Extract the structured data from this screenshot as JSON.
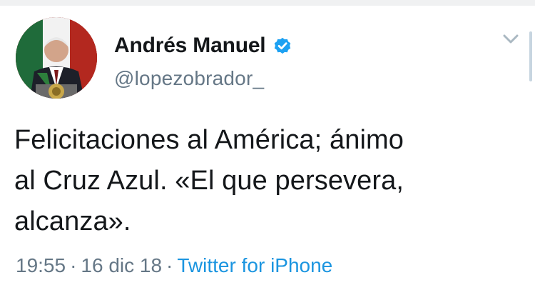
{
  "user": {
    "display_name": "Andrés Manuel",
    "handle": "@lopezobrador_",
    "verified_icon": "verified-badge-icon"
  },
  "tweet": {
    "text_line1": "Felicitaciones al América; ánimo",
    "text_line2": "al Cruz Azul. «El que persevera,",
    "text_line3": "alcanza»."
  },
  "meta": {
    "time": "19:55",
    "separator": "·",
    "date": "16 dic 18",
    "source": "Twitter for iPhone"
  },
  "icons": {
    "menu": "chevron-down-icon"
  },
  "colors": {
    "text": "#14171a",
    "secondary": "#657786",
    "link": "#1b95e0",
    "verified": "#1da1f2"
  }
}
